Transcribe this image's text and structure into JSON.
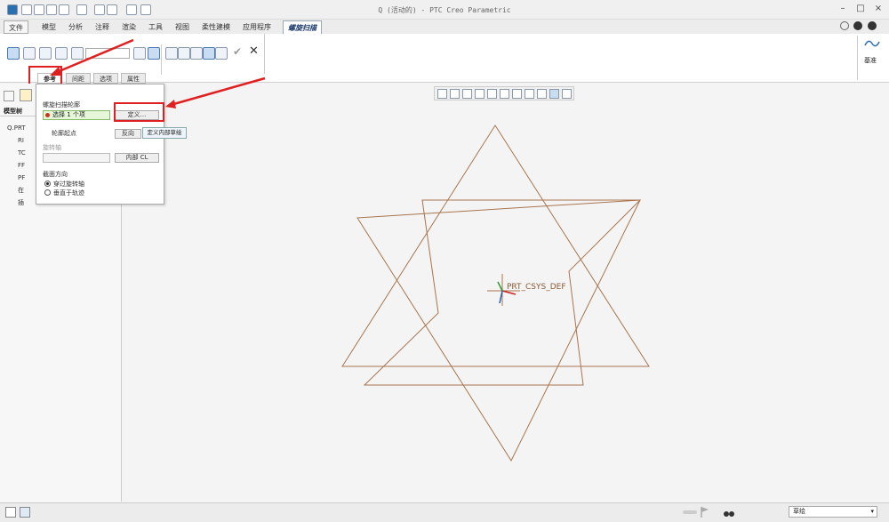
{
  "window": {
    "title": "Q (活动的) - PTC Creo Parametric"
  },
  "menu": {
    "tabs": [
      "文件",
      "模型",
      "分析",
      "注释",
      "渲染",
      "工具",
      "视图",
      "柔性建模",
      "应用程序",
      "螺旋扫描"
    ],
    "active_index": 9
  },
  "ribbon": {
    "datum_label": "基准"
  },
  "dashboard": {
    "tabs": [
      "参考",
      "间距",
      "选项",
      "属性"
    ],
    "active_index": 0
  },
  "refs_panel": {
    "profile_heading": "螺旋扫描轮廓",
    "profile_field": "选择 1 个项",
    "define_button": "定义...",
    "start_label": "轮廓起点",
    "reverse_button": "反向",
    "axis_label": "旋转轴",
    "internal_button": "内部 CL",
    "section_heading": "截面方向",
    "options": [
      "穿过旋转轴",
      "垂直于轨迹"
    ],
    "selected_option": 0
  },
  "tooltip": {
    "text": "定义内部草绘"
  },
  "model_tree": {
    "tab_label": "模型树",
    "items": [
      "Q.PRT",
      "RI",
      "TC",
      "FF",
      "PF",
      "在",
      "插"
    ]
  },
  "graphics": {
    "csys_label": "PRT_CSYS_DEF",
    "sketch_color": "#a8754e"
  },
  "status": {
    "filter_value": "草绘"
  },
  "colors": {
    "highlight": "#e02020"
  }
}
